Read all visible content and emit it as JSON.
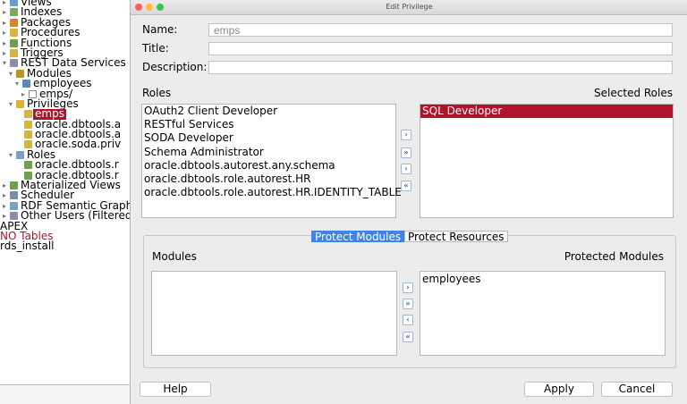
{
  "tree": {
    "items": [
      {
        "label": "Views"
      },
      {
        "label": "Indexes"
      },
      {
        "label": "Packages"
      },
      {
        "label": "Procedures"
      },
      {
        "label": "Functions"
      },
      {
        "label": "Triggers"
      },
      {
        "label": "REST Data Services"
      },
      {
        "label": "Modules"
      },
      {
        "label": "employees"
      },
      {
        "label": "emps/"
      },
      {
        "label": "Privileges"
      },
      {
        "label": "emps"
      },
      {
        "label": "oracle.dbtools.a"
      },
      {
        "label": "oracle.dbtools.a"
      },
      {
        "label": "oracle.soda.priv"
      },
      {
        "label": "Roles"
      },
      {
        "label": "oracle.dbtools.r"
      },
      {
        "label": "oracle.dbtools.r"
      },
      {
        "label": "Materialized Views"
      },
      {
        "label": "Scheduler"
      },
      {
        "label": "RDF Semantic Graph"
      },
      {
        "label": "Other Users (Filtered"
      },
      {
        "label": "APEX"
      },
      {
        "label": "NO Tables"
      },
      {
        "label": "rds_install"
      }
    ]
  },
  "dialog": {
    "title": "Edit Privilege",
    "fields": {
      "name_label": "Name:",
      "name_value": "emps",
      "title_label": "Title:",
      "title_value": "",
      "description_label": "Description:",
      "description_value": ""
    },
    "roles": {
      "header": "Roles",
      "selected_header": "Selected Roles",
      "available": [
        "OAuth2 Client Developer",
        "RESTful Services",
        "SODA Developer",
        "Schema Administrator",
        "oracle.dbtools.autorest.any.schema",
        "oracle.dbtools.role.autorest.HR",
        "oracle.dbtools.role.autorest.HR.IDENTITY_TABLE"
      ],
      "selected": [
        "SQL Developer"
      ]
    },
    "tabs": [
      "Protect Modules",
      "Protect Resources"
    ],
    "modules": {
      "header": "Modules",
      "protected_header": "Protected Modules",
      "available": [],
      "protected": [
        "employees"
      ]
    },
    "buttons": {
      "help": "Help",
      "apply": "Apply",
      "cancel": "Cancel"
    },
    "move_buttons": {
      "move_right": "›",
      "move_all_right": "»",
      "move_left": "‹",
      "move_all_left": "«"
    }
  }
}
